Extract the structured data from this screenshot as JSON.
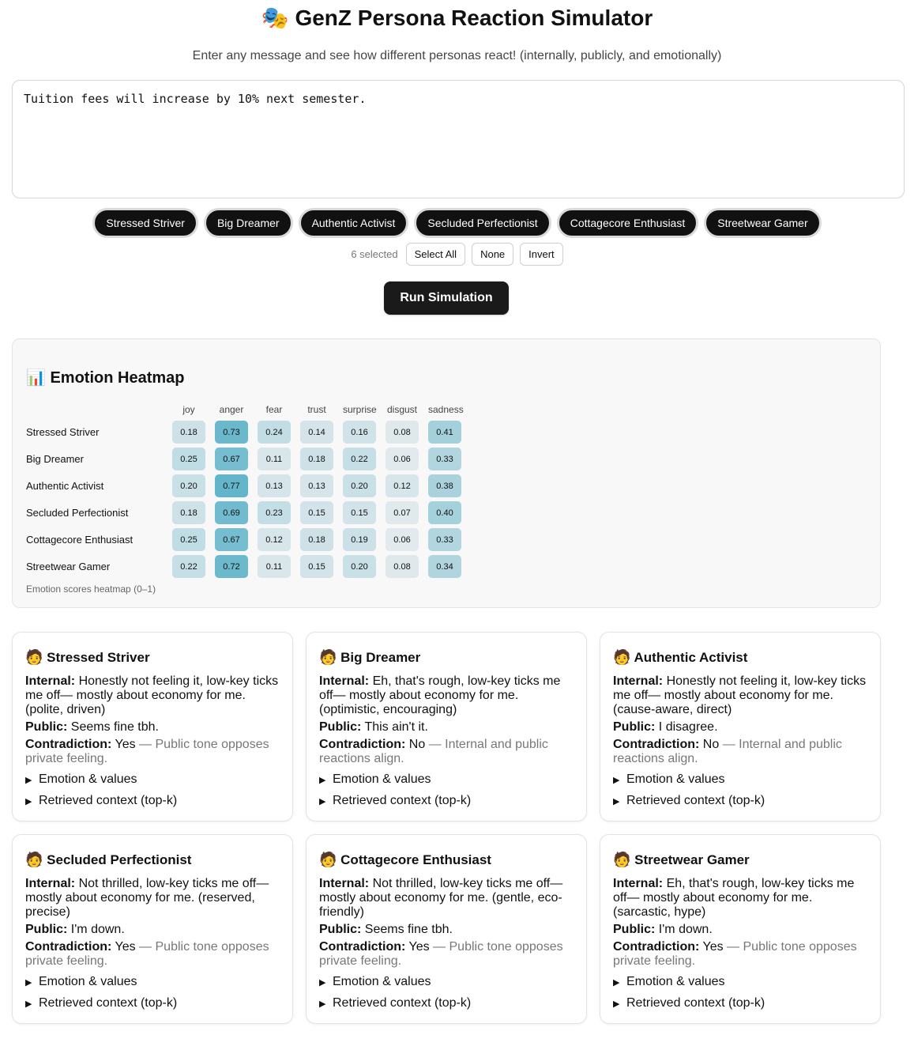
{
  "app": {
    "title_icon": "🎭",
    "title": "GenZ Persona Reaction Simulator",
    "subtitle": "Enter any message and see how different personas react! (internally, publicly, and emotionally)"
  },
  "input": {
    "value": "Tuition fees will increase by 10% next semester."
  },
  "personas": [
    "Stressed Striver",
    "Big Dreamer",
    "Authentic Activist",
    "Secluded Perfectionist",
    "Cottagecore Enthusiast",
    "Streetwear Gamer"
  ],
  "selection": {
    "count_label": "6 selected",
    "select_all": "Select All",
    "none": "None",
    "invert": "Invert"
  },
  "run_label": "Run Simulation",
  "heatmap": {
    "title_icon": "📊",
    "title": "Emotion Heatmap",
    "emotions": [
      "joy",
      "anger",
      "fear",
      "trust",
      "surprise",
      "disgust",
      "sadness"
    ],
    "rows": [
      {
        "persona": "Stressed Striver",
        "values": [
          "0.18",
          "0.73",
          "0.24",
          "0.14",
          "0.16",
          "0.08",
          "0.41"
        ]
      },
      {
        "persona": "Big Dreamer",
        "values": [
          "0.25",
          "0.67",
          "0.11",
          "0.18",
          "0.22",
          "0.06",
          "0.33"
        ]
      },
      {
        "persona": "Authentic Activist",
        "values": [
          "0.20",
          "0.77",
          "0.13",
          "0.13",
          "0.20",
          "0.12",
          "0.38"
        ]
      },
      {
        "persona": "Secluded Perfectionist",
        "values": [
          "0.18",
          "0.69",
          "0.23",
          "0.15",
          "0.15",
          "0.07",
          "0.40"
        ]
      },
      {
        "persona": "Cottagecore Enthusiast",
        "values": [
          "0.25",
          "0.67",
          "0.12",
          "0.18",
          "0.19",
          "0.06",
          "0.33"
        ]
      },
      {
        "persona": "Streetwear Gamer",
        "values": [
          "0.22",
          "0.72",
          "0.11",
          "0.15",
          "0.20",
          "0.08",
          "0.34"
        ]
      }
    ],
    "caption": "Emotion scores heatmap (0–1)"
  },
  "labels": {
    "internal": "Internal:",
    "public": "Public:",
    "contradiction": "Contradiction:",
    "emotion_details": "Emotion & values",
    "context_details": "Retrieved context (top-k)"
  },
  "cards": [
    {
      "avatar": "🧑",
      "name": "Stressed Striver",
      "internal": "Honestly not feeling it, low-key ticks me off— mostly about economy for me. (polite, driven)",
      "public": "Seems fine tbh.",
      "contradiction": "Yes",
      "contradiction_note": "— Public tone opposes private feeling."
    },
    {
      "avatar": "🧑",
      "name": "Big Dreamer",
      "internal": "Eh, that's rough, low-key ticks me off— mostly about economy for me. (optimistic, encouraging)",
      "public": "This ain't it.",
      "contradiction": "No",
      "contradiction_note": "— Internal and public reactions align."
    },
    {
      "avatar": "🧑",
      "name": "Authentic Activist",
      "internal": "Honestly not feeling it, low-key ticks me off— mostly about economy for me. (cause-aware, direct)",
      "public": "I disagree.",
      "contradiction": "No",
      "contradiction_note": "— Internal and public reactions align."
    },
    {
      "avatar": "🧑",
      "name": "Secluded Perfectionist",
      "internal": "Not thrilled, low-key ticks me off— mostly about economy for me. (reserved, precise)",
      "public": "I'm down.",
      "contradiction": "Yes",
      "contradiction_note": "— Public tone opposes private feeling."
    },
    {
      "avatar": "🧑",
      "name": "Cottagecore Enthusiast",
      "internal": "Not thrilled, low-key ticks me off— mostly about economy for me. (gentle, eco-friendly)",
      "public": "Seems fine tbh.",
      "contradiction": "Yes",
      "contradiction_note": "— Public tone opposes private feeling."
    },
    {
      "avatar": "🧑",
      "name": "Streetwear Gamer",
      "internal": "Eh, that's rough, low-key ticks me off— mostly about economy for me. (sarcastic, hype)",
      "public": "I'm down.",
      "contradiction": "Yes",
      "contradiction_note": "— Public tone opposes private feeling."
    }
  ],
  "colors": {
    "heat_low": "#e4ebee",
    "heat_high": "#5eb3c8",
    "chip_bg": "#111111"
  }
}
